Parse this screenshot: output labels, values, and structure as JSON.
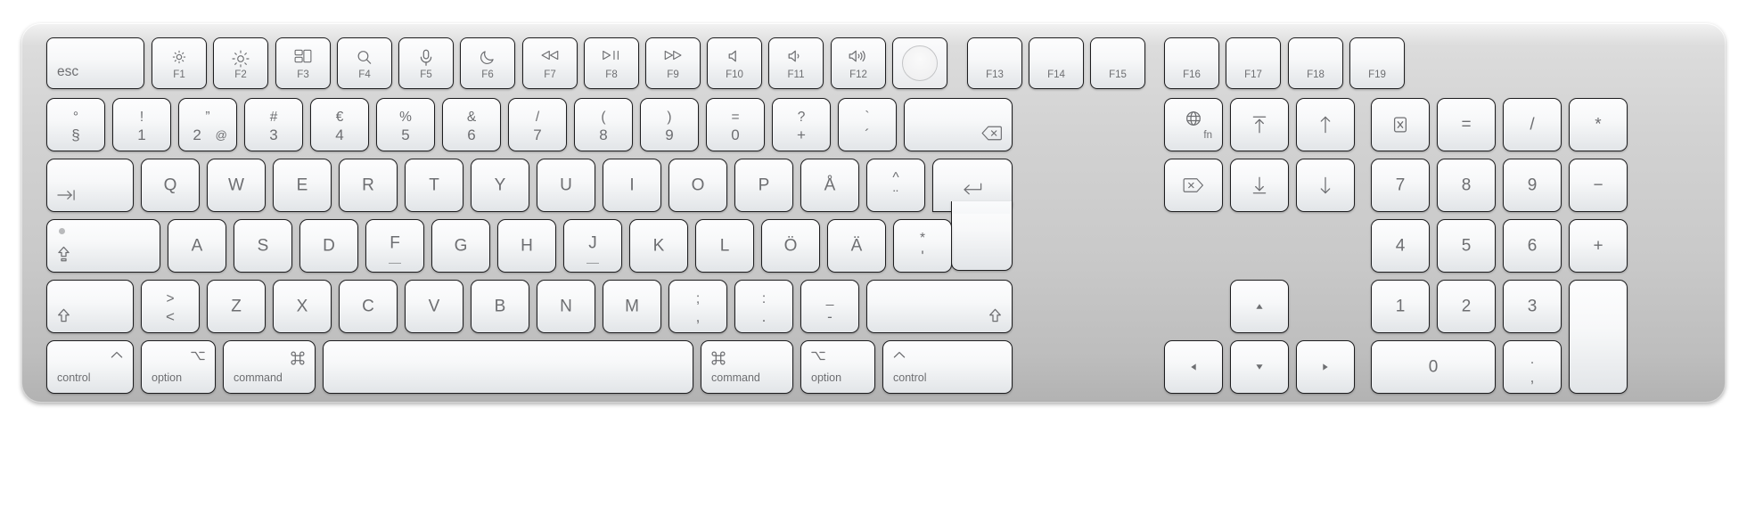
{
  "device": {
    "name": "Apple Magic Keyboard with Touch ID and Numeric Keypad",
    "layout": "Swedish (ISO)",
    "body_color": "#c9c9c9",
    "key_color": "#f5f6f7",
    "legend_color": "#6d6e71",
    "key_border_color": "#1d1d1f"
  },
  "rows": {
    "function_row": [
      {
        "name": "esc",
        "label": "esc",
        "icon": null,
        "sub": null
      },
      {
        "name": "f1",
        "label": "F1",
        "icon": "brightness-down-icon",
        "sub": null
      },
      {
        "name": "f2",
        "label": "F2",
        "icon": "brightness-up-icon",
        "sub": null
      },
      {
        "name": "f3",
        "label": "F3",
        "icon": "mission-control-icon",
        "sub": null
      },
      {
        "name": "f4",
        "label": "F4",
        "icon": "spotlight-search-icon",
        "sub": null
      },
      {
        "name": "f5",
        "label": "F5",
        "icon": "dictation-mic-icon",
        "sub": null
      },
      {
        "name": "f6",
        "label": "F6",
        "icon": "do-not-disturb-moon-icon",
        "sub": null
      },
      {
        "name": "f7",
        "label": "F7",
        "icon": "rewind-icon",
        "sub": null
      },
      {
        "name": "f8",
        "label": "F8",
        "icon": "play-pause-icon",
        "sub": null
      },
      {
        "name": "f9",
        "label": "F9",
        "icon": "fast-forward-icon",
        "sub": null
      },
      {
        "name": "f10",
        "label": "F10",
        "icon": "mute-icon",
        "sub": null
      },
      {
        "name": "f11",
        "label": "F11",
        "icon": "volume-down-icon",
        "sub": null
      },
      {
        "name": "f12",
        "label": "F12",
        "icon": "volume-up-icon",
        "sub": null
      },
      {
        "name": "touch-id",
        "label": "",
        "icon": "touch-id-icon",
        "sub": null
      },
      {
        "name": "f13",
        "label": "F13",
        "icon": null,
        "sub": null
      },
      {
        "name": "f14",
        "label": "F14",
        "icon": null,
        "sub": null
      },
      {
        "name": "f15",
        "label": "F15",
        "icon": null,
        "sub": null
      },
      {
        "name": "f16",
        "label": "F16",
        "icon": null,
        "sub": null
      },
      {
        "name": "f17",
        "label": "F17",
        "icon": null,
        "sub": null
      },
      {
        "name": "f18",
        "label": "F18",
        "icon": null,
        "sub": null
      },
      {
        "name": "f19",
        "label": "F19",
        "icon": null,
        "sub": null
      }
    ],
    "number_row": [
      {
        "name": "section",
        "upper": "°",
        "lower": "§"
      },
      {
        "name": "digit-1",
        "upper": "!",
        "lower": "1"
      },
      {
        "name": "digit-2",
        "upper": "”",
        "lower": "2",
        "extra": "@"
      },
      {
        "name": "digit-3",
        "upper": "#",
        "lower": "3"
      },
      {
        "name": "digit-4",
        "upper": "€",
        "lower": "4"
      },
      {
        "name": "digit-5",
        "upper": "%",
        "lower": "5"
      },
      {
        "name": "digit-6",
        "upper": "&",
        "lower": "6"
      },
      {
        "name": "digit-7",
        "upper": "/",
        "lower": "7"
      },
      {
        "name": "digit-8",
        "upper": "(",
        "lower": "8"
      },
      {
        "name": "digit-9",
        "upper": ")",
        "lower": "9"
      },
      {
        "name": "digit-0",
        "upper": "=",
        "lower": "0"
      },
      {
        "name": "plus",
        "upper": "?",
        "lower": "+"
      },
      {
        "name": "acute",
        "upper": "`",
        "lower": "´"
      },
      {
        "name": "delete",
        "upper": "",
        "lower": "",
        "icon": "backspace-delete-icon"
      }
    ],
    "top_letter_row": [
      {
        "name": "tab",
        "label": "",
        "icon": "tab-icon"
      },
      {
        "name": "q",
        "label": "Q"
      },
      {
        "name": "w",
        "label": "W"
      },
      {
        "name": "e",
        "label": "E"
      },
      {
        "name": "r",
        "label": "R"
      },
      {
        "name": "t",
        "label": "T"
      },
      {
        "name": "y",
        "label": "Y"
      },
      {
        "name": "u",
        "label": "U"
      },
      {
        "name": "i",
        "label": "I"
      },
      {
        "name": "o",
        "label": "O"
      },
      {
        "name": "p",
        "label": "P"
      },
      {
        "name": "aring",
        "label": "Å"
      },
      {
        "name": "diaeresis",
        "upper": "^",
        "lower": "¨"
      },
      {
        "name": "return",
        "label": "",
        "icon": "return-icon"
      }
    ],
    "home_row": [
      {
        "name": "caps-lock",
        "label": "",
        "icon": "caps-lock-icon",
        "indicator": true
      },
      {
        "name": "a",
        "label": "A"
      },
      {
        "name": "s",
        "label": "S"
      },
      {
        "name": "d",
        "label": "D"
      },
      {
        "name": "f",
        "label": "F",
        "homing": true
      },
      {
        "name": "g",
        "label": "G"
      },
      {
        "name": "h",
        "label": "H"
      },
      {
        "name": "j",
        "label": "J",
        "homing": true
      },
      {
        "name": "k",
        "label": "K"
      },
      {
        "name": "l",
        "label": "L"
      },
      {
        "name": "odiaeresis",
        "label": "Ö"
      },
      {
        "name": "adiaeresis",
        "label": "Ä"
      },
      {
        "name": "apostrophe",
        "upper": "*",
        "lower": "'"
      }
    ],
    "bottom_letter_row": [
      {
        "name": "shift-left",
        "label": "",
        "icon": "shift-icon"
      },
      {
        "name": "less-greater",
        "upper": ">",
        "lower": "<"
      },
      {
        "name": "z",
        "label": "Z"
      },
      {
        "name": "x",
        "label": "X"
      },
      {
        "name": "c",
        "label": "C"
      },
      {
        "name": "v",
        "label": "V"
      },
      {
        "name": "b",
        "label": "B"
      },
      {
        "name": "n",
        "label": "N"
      },
      {
        "name": "m",
        "label": "M"
      },
      {
        "name": "comma",
        "upper": ";",
        "lower": ","
      },
      {
        "name": "period",
        "upper": ":",
        "lower": "."
      },
      {
        "name": "minus",
        "upper": "_",
        "lower": "-"
      },
      {
        "name": "shift-right",
        "label": "",
        "icon": "shift-icon"
      }
    ],
    "modifier_row": [
      {
        "name": "control-left",
        "label": "control",
        "icon": "control-caret-icon"
      },
      {
        "name": "option-left",
        "label": "option",
        "icon": "option-icon"
      },
      {
        "name": "command-left",
        "label": "command",
        "icon": "command-icon"
      },
      {
        "name": "space",
        "label": "",
        "icon": null
      },
      {
        "name": "command-right",
        "label": "command",
        "icon": "command-icon"
      },
      {
        "name": "option-right",
        "label": "option",
        "icon": "option-icon"
      },
      {
        "name": "control-right",
        "label": "control",
        "icon": "control-caret-icon"
      }
    ],
    "nav_cluster": [
      {
        "name": "fn-globe",
        "label": "fn",
        "icon": "globe-icon"
      },
      {
        "name": "home",
        "label": "",
        "icon": "home-arrow-up-bar-icon"
      },
      {
        "name": "page-up",
        "label": "",
        "icon": "arrow-up-icon"
      },
      {
        "name": "forward-delete",
        "label": "",
        "icon": "forward-delete-icon"
      },
      {
        "name": "end",
        "label": "",
        "icon": "end-arrow-down-bar-icon"
      },
      {
        "name": "page-down",
        "label": "",
        "icon": "arrow-down-icon"
      },
      {
        "name": "arrow-up",
        "label": "",
        "icon": "arrow-up-small-icon"
      },
      {
        "name": "arrow-left",
        "label": "",
        "icon": "arrow-left-small-icon"
      },
      {
        "name": "arrow-down",
        "label": "",
        "icon": "arrow-down-small-icon"
      },
      {
        "name": "arrow-right",
        "label": "",
        "icon": "arrow-right-small-icon"
      }
    ],
    "numeric_keypad": [
      {
        "name": "numpad-clear",
        "label": "",
        "icon": "clear-icon"
      },
      {
        "name": "numpad-equal",
        "label": "="
      },
      {
        "name": "numpad-divide",
        "label": "/"
      },
      {
        "name": "numpad-multiply",
        "label": "*"
      },
      {
        "name": "numpad-7",
        "label": "7"
      },
      {
        "name": "numpad-8",
        "label": "8"
      },
      {
        "name": "numpad-9",
        "label": "9"
      },
      {
        "name": "numpad-minus",
        "label": "−"
      },
      {
        "name": "numpad-4",
        "label": "4"
      },
      {
        "name": "numpad-5",
        "label": "5"
      },
      {
        "name": "numpad-6",
        "label": "6"
      },
      {
        "name": "numpad-plus",
        "label": "+"
      },
      {
        "name": "numpad-1",
        "label": "1"
      },
      {
        "name": "numpad-2",
        "label": "2"
      },
      {
        "name": "numpad-3",
        "label": "3"
      },
      {
        "name": "numpad-enter",
        "label": ""
      },
      {
        "name": "numpad-0",
        "label": "0"
      },
      {
        "name": "numpad-decimal",
        "upper": ".",
        "lower": ","
      }
    ]
  }
}
